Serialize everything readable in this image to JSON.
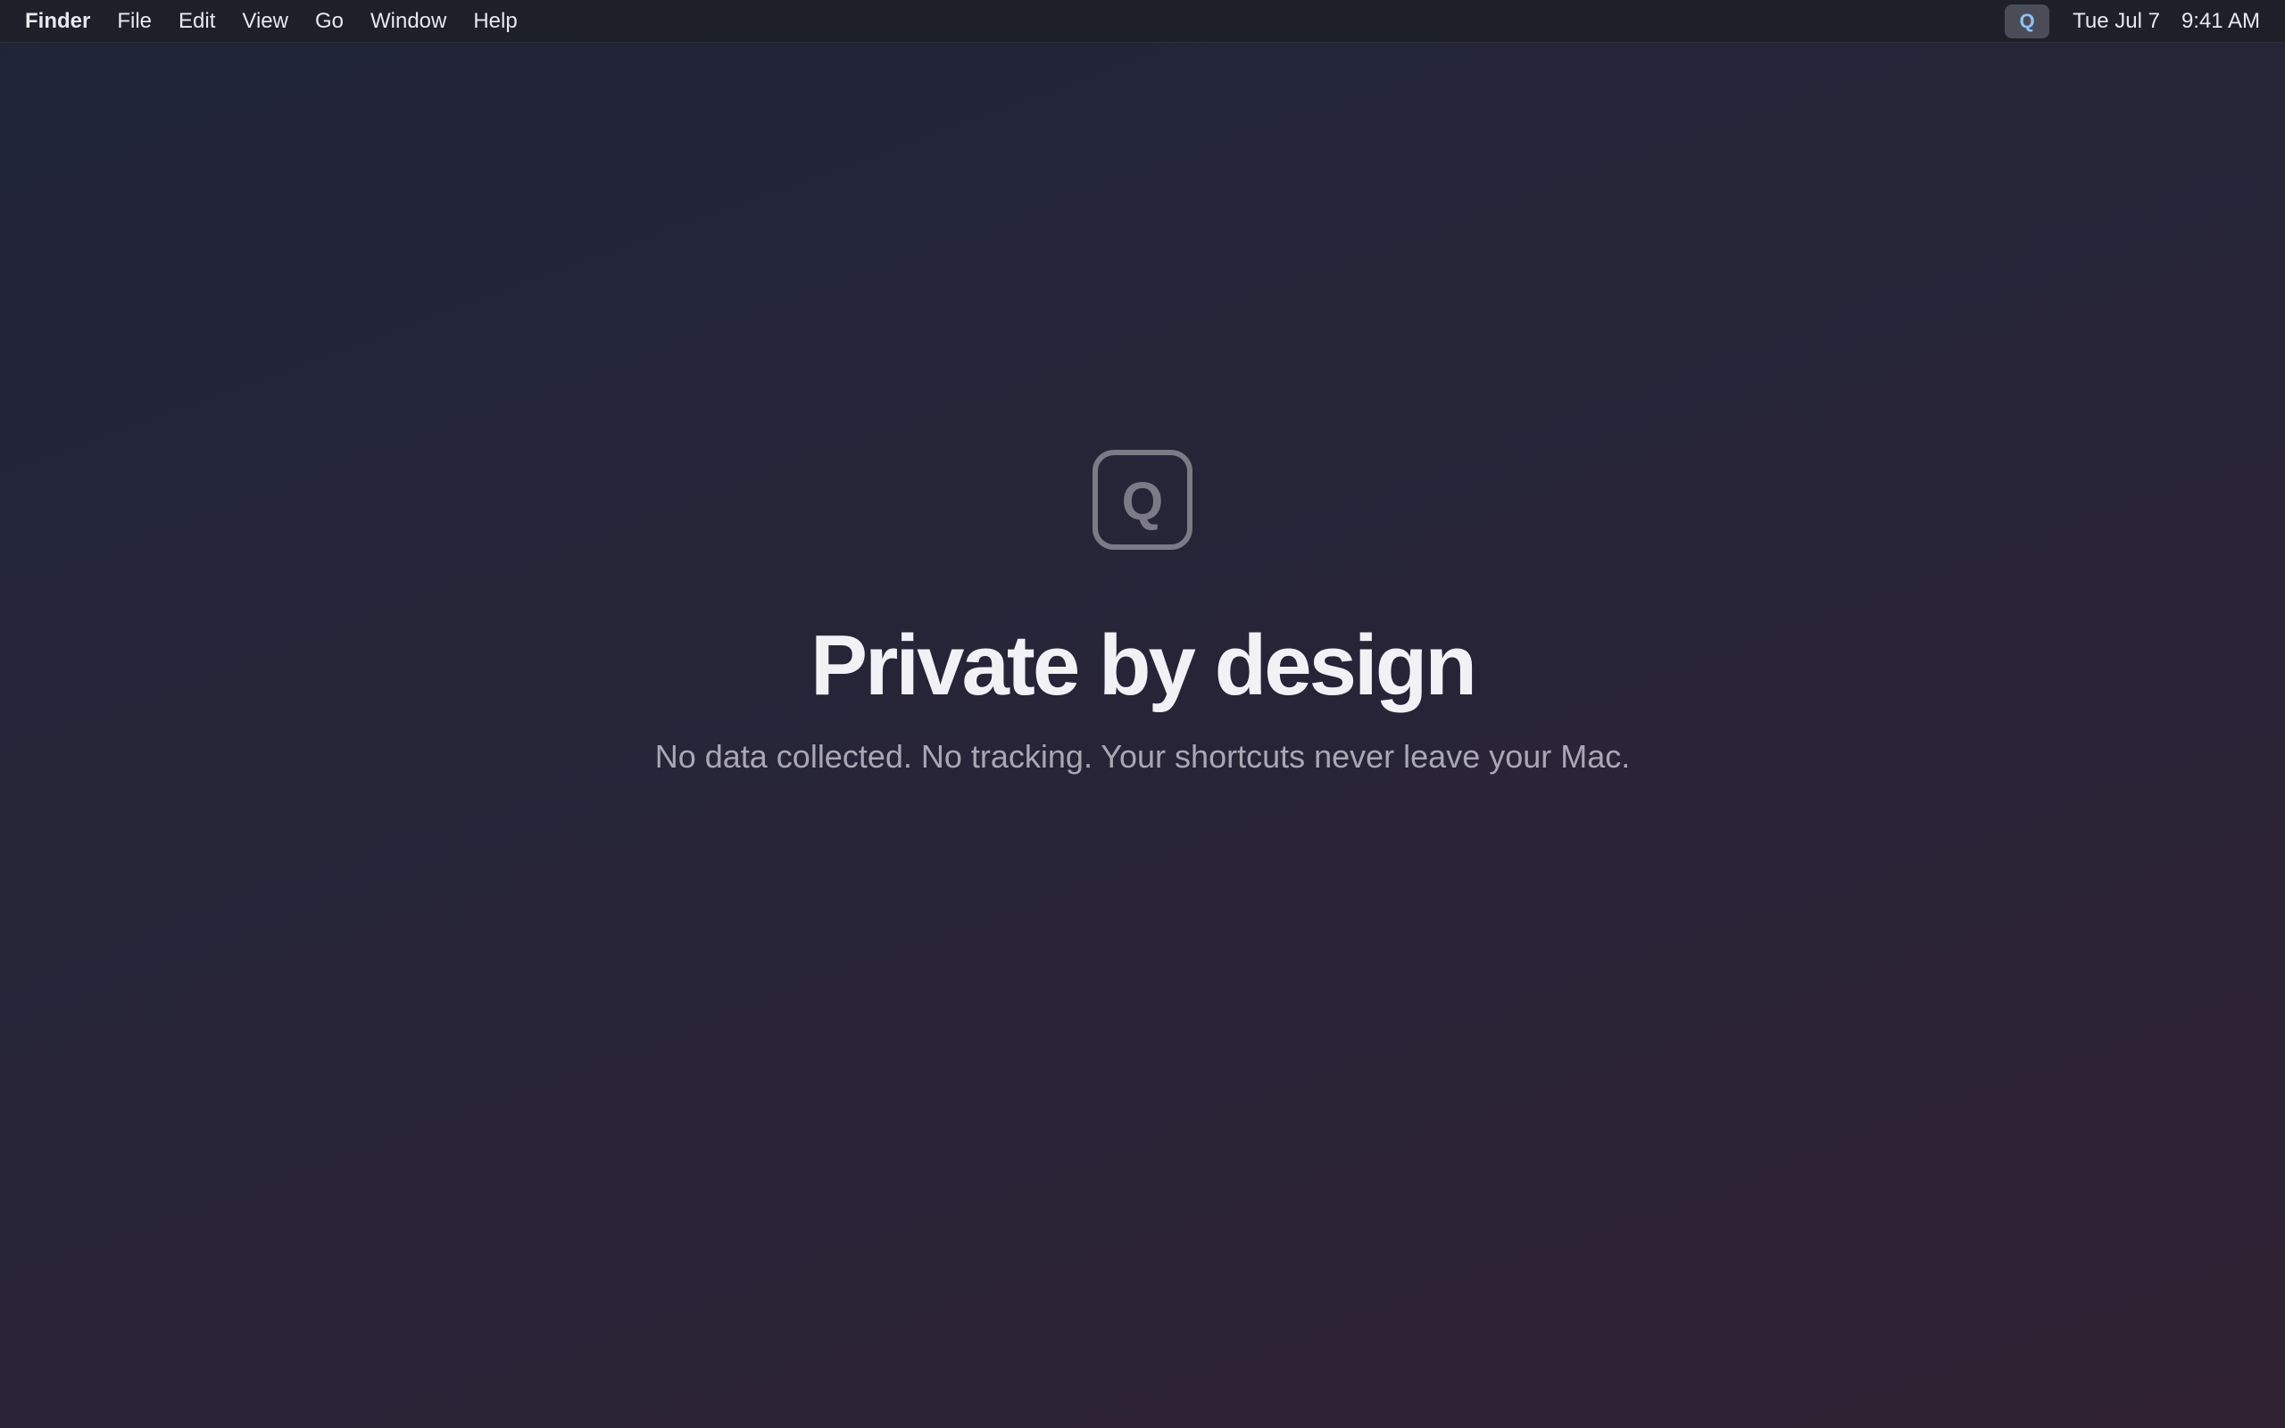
{
  "menubar": {
    "app_name": "Finder",
    "items": [
      "File",
      "Edit",
      "View",
      "Go",
      "Window",
      "Help"
    ],
    "status_app_icon": {
      "glyph": "Q",
      "icon": "quick-shortcuts-app-icon",
      "color": "#8fc2f5"
    },
    "date": "Tue Jul 7",
    "time": "9:41 AM"
  },
  "hero": {
    "icon": {
      "glyph": "Q",
      "icon": "app-logo-icon",
      "color": "#7c7a86"
    },
    "title": "Private by design",
    "subtitle": "No data collected. No tracking. Your shortcuts never leave your Mac."
  }
}
